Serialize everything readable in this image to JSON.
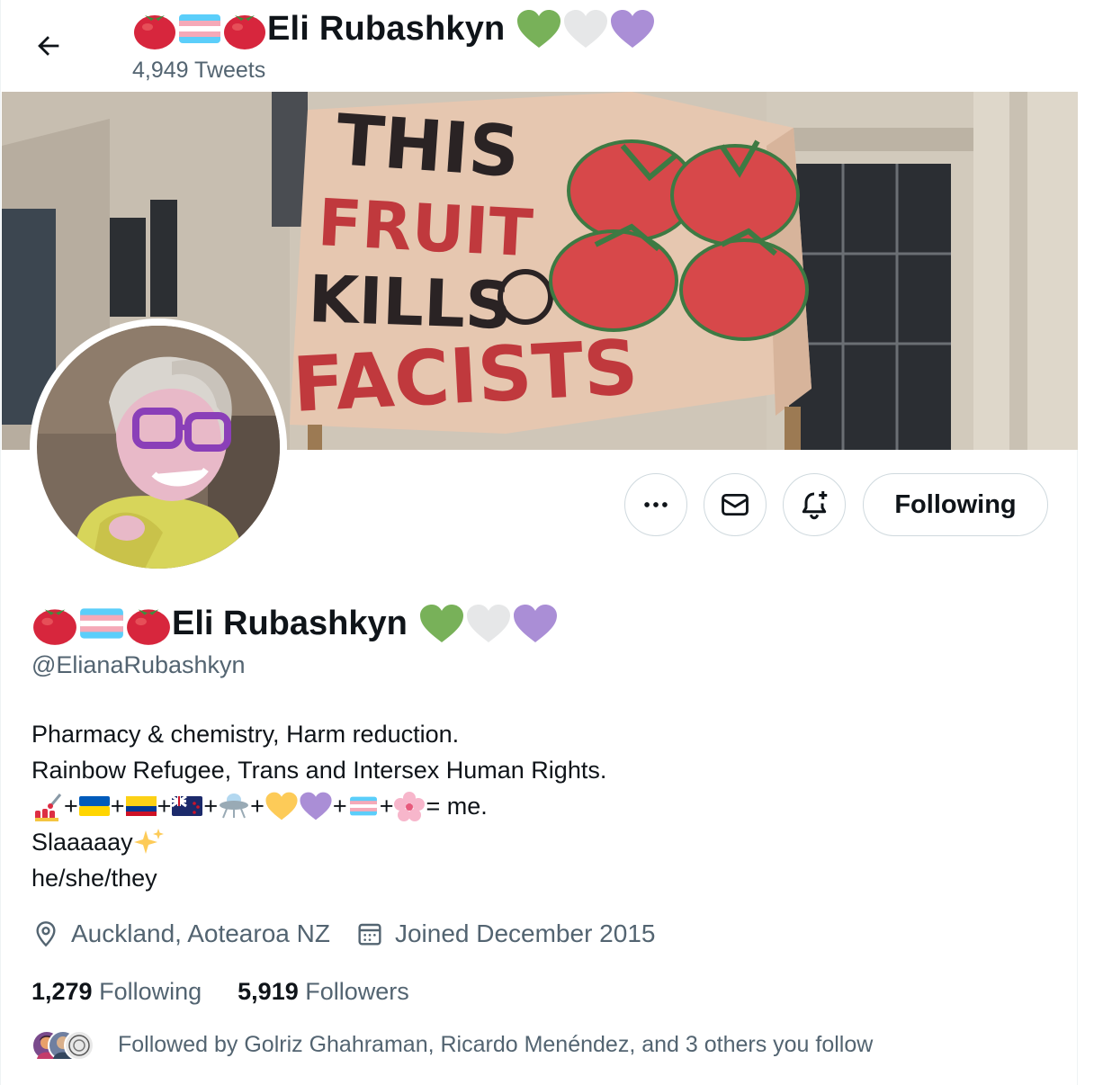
{
  "header": {
    "display_name": "Eli Rubashkyn",
    "tweet_count": "4,949 Tweets",
    "name_prefix_icons": [
      "tomato-icon",
      "transgender-flag-icon",
      "tomato-icon"
    ],
    "name_suffix_icons": [
      "green-heart-icon",
      "white-heart-icon",
      "purple-heart-icon"
    ]
  },
  "banner": {
    "sign_lines": [
      "THIS",
      "FRUIT",
      "KILLS",
      "FACISTS"
    ]
  },
  "actions": {
    "more_icon": "more-icon",
    "message_icon": "mail-icon",
    "notify_icon": "bell-plus-icon",
    "following_label": "Following"
  },
  "profile": {
    "display_name": "Eli Rubashkyn",
    "handle": "@ElianaRubashkyn",
    "bio": {
      "line1": "Pharmacy & chemistry, Harm reduction.",
      "line2": "Rainbow Refugee, Trans and Intersex Human Rights.",
      "line3_plus": "+",
      "line3_end": "= me.",
      "line3_icons": [
        "nail-polish-icon",
        "ukraine-flag-icon",
        "colombia-flag-icon",
        "new-zealand-flag-icon",
        "ufo-icon",
        "yellow-heart-icon",
        "purple-heart-icon",
        "transgender-flag-icon",
        "cherry-blossom-icon"
      ],
      "line4": "Slaaaaay",
      "line4_icon": "sparkles-icon",
      "line5": "he/she/they"
    },
    "location": "Auckland, Aotearoa NZ",
    "joined": "Joined December 2015",
    "following_count": "1,279",
    "following_label": "Following",
    "followers_count": "5,919",
    "followers_label": "Followers",
    "followed_by": "Followed by Golriz Ghahraman, Ricardo Menéndez, and 3 others you follow"
  },
  "colors": {
    "text_primary": "#0f1419",
    "text_secondary": "#536471",
    "border": "#cfd9de",
    "tomato": "#d7263d",
    "trans_blue": "#5bcefa",
    "trans_pink": "#f5a9b8",
    "heart_green": "#78b159",
    "heart_white": "#e6e7e8",
    "heart_purple": "#aa8ed6"
  }
}
